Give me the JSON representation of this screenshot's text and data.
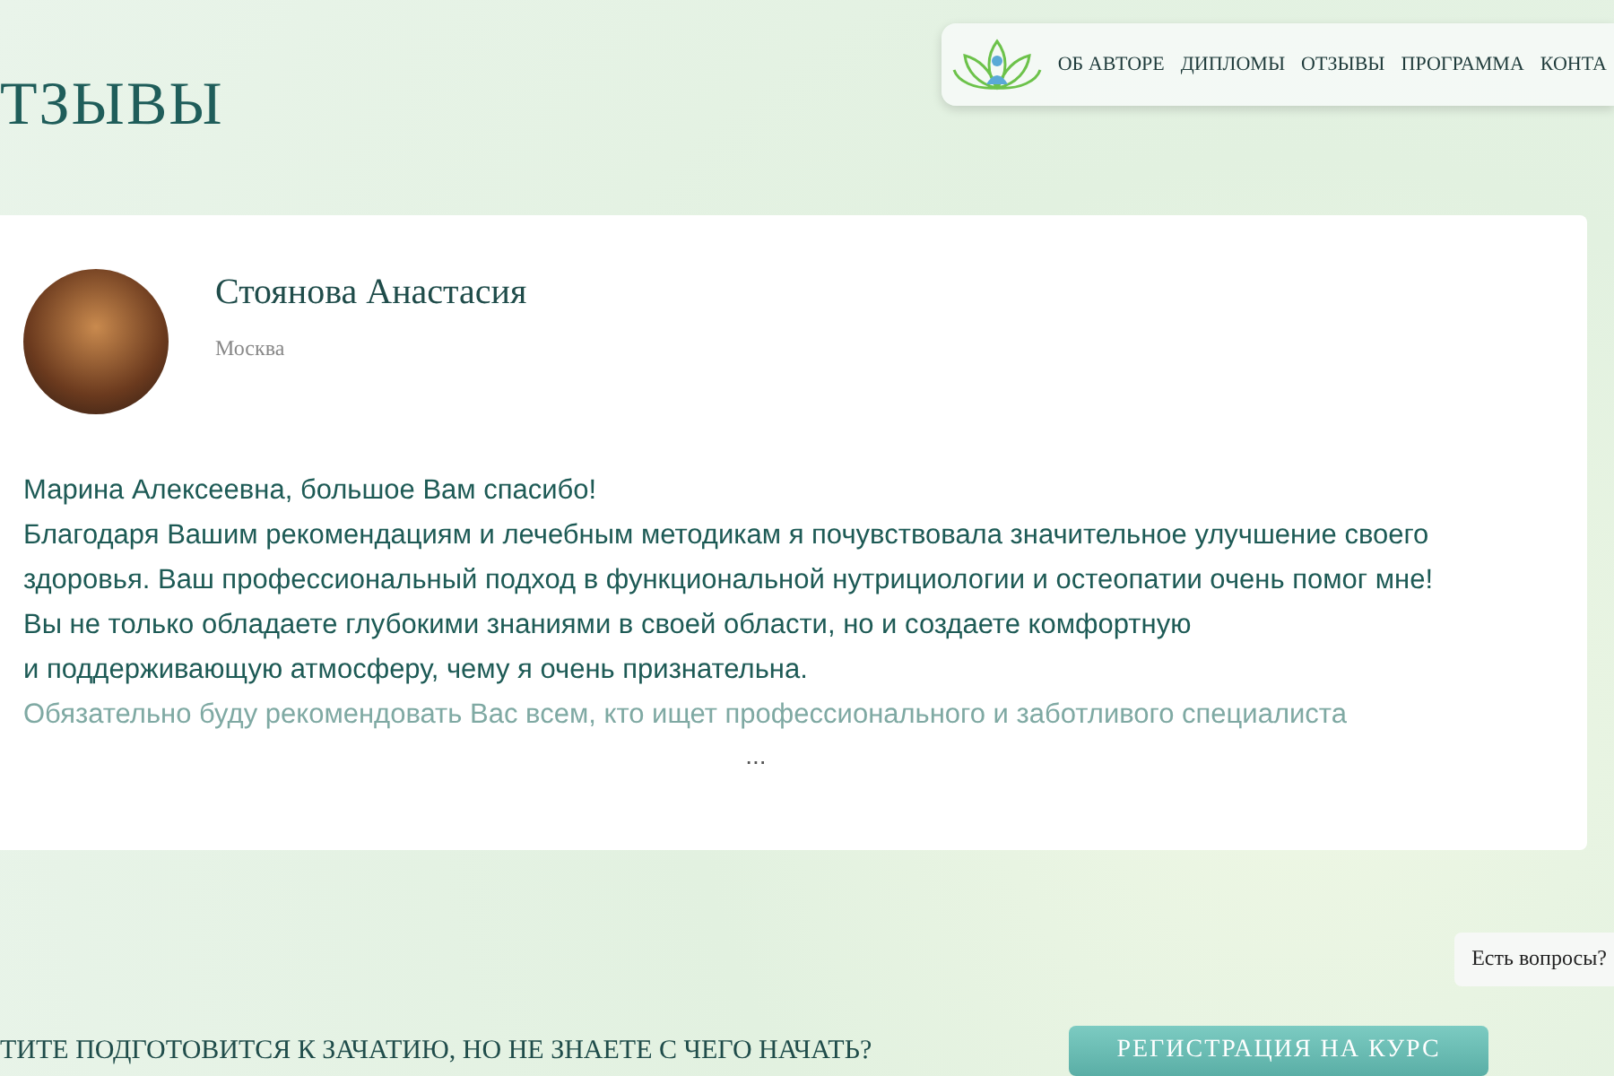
{
  "nav": {
    "items": [
      "ОБ АВТОРЕ",
      "ДИПЛОМЫ",
      "ОТЗЫВЫ",
      "ПРОГРАММА",
      "КОНТА"
    ]
  },
  "section_title": "ТЗЫВЫ",
  "review": {
    "name": "Стоянова Анастасия",
    "city": "Москва",
    "lines": [
      {
        "text": "Марина Алексеевна, большое Вам спасибо!",
        "faded": false
      },
      {
        "text": "Благодаря Вашим рекомендациям и лечебным методикам я почувствовала значительное улучшение своего здоровья. Ваш профессиональный подход в функциональной нутрициологии и остеопатии очень помог мне!",
        "faded": false
      },
      {
        "text": "Вы не только обладаете глубокими знаниями в своей области, но и создаете комфортную",
        "faded": false
      },
      {
        "text": "и поддерживающую атмосферу, чему я очень признательна.",
        "faded": false
      },
      {
        "text": "Обязательно буду рекомендовать Вас всем, кто ищет профессионального и заботливого специалиста",
        "faded": true
      }
    ],
    "more": "..."
  },
  "question_tab": "Есть вопросы?",
  "cta": {
    "text": "ТИТЕ ПОДГОТОВИТСЯ К ЗАЧАТИЮ, НО НЕ ЗНАЕТЕ С ЧЕГО НАЧАТЬ?",
    "button": "РЕГИСТРАЦИЯ НА КУРС"
  }
}
